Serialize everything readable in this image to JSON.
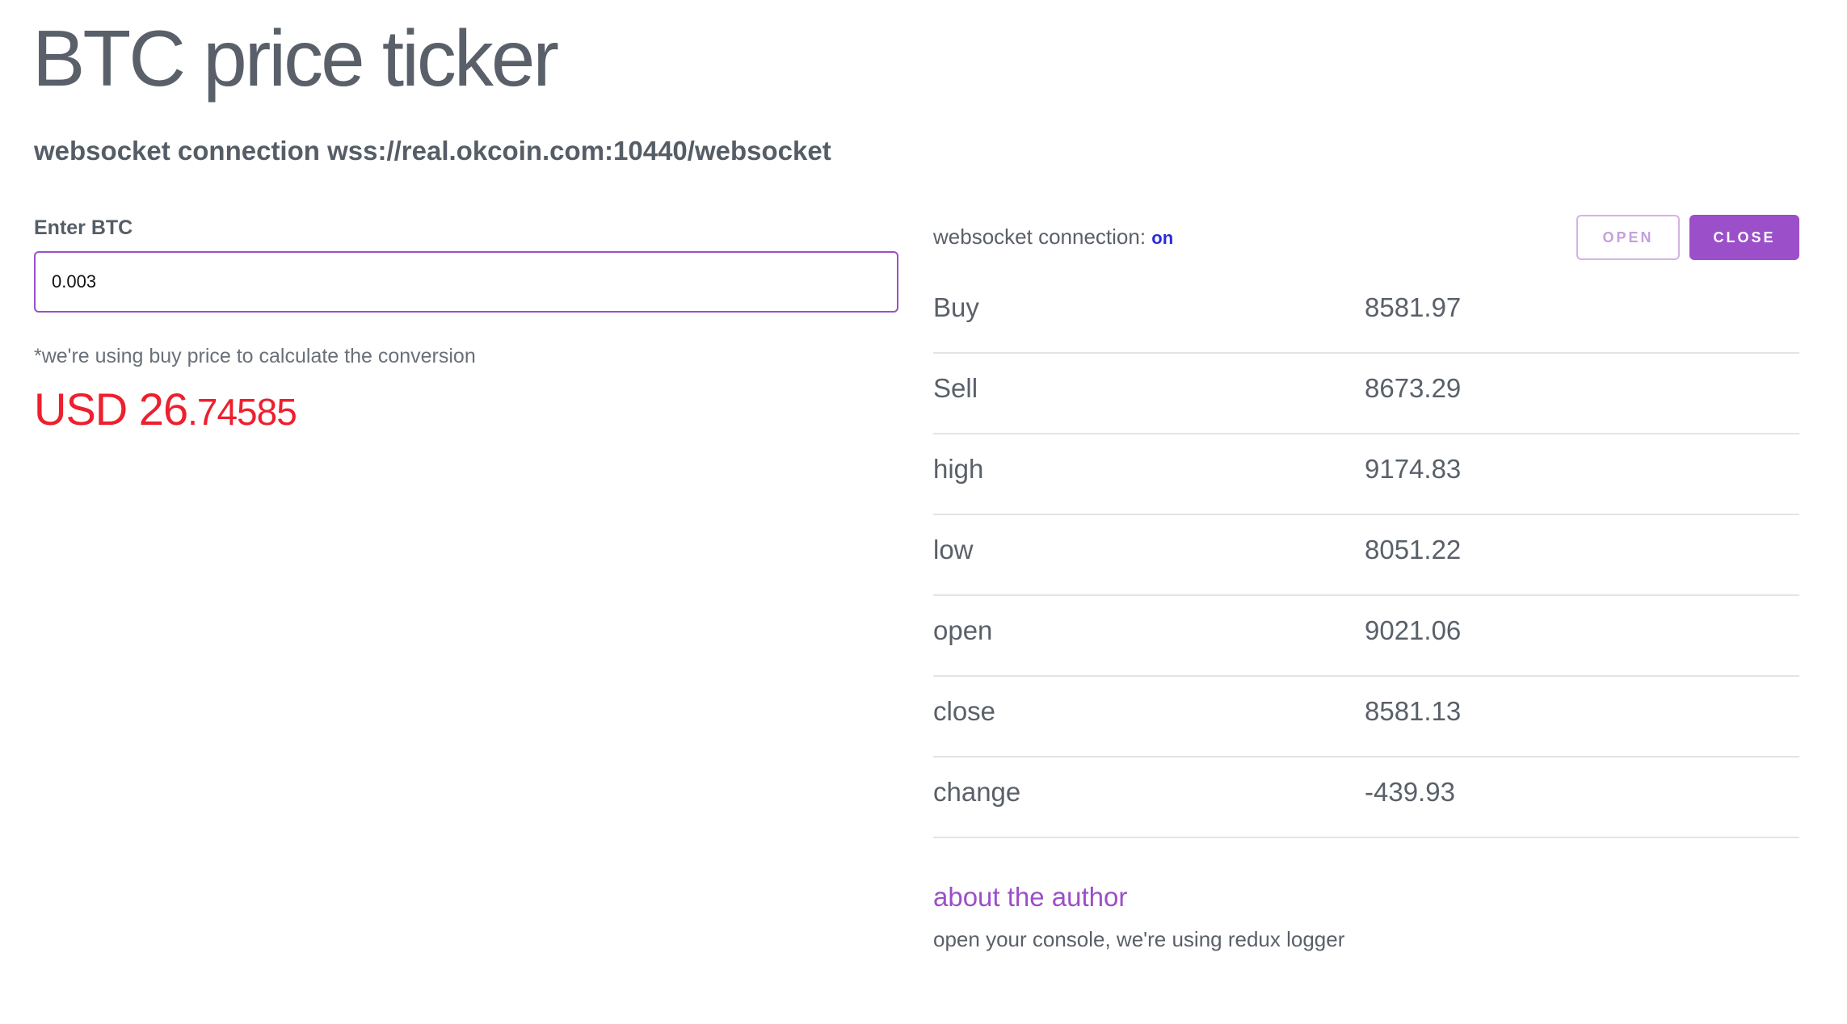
{
  "header": {
    "title": "BTC price ticker",
    "subtitle": "websocket connection wss://real.okcoin.com:10440/websocket"
  },
  "converter": {
    "label": "Enter BTC",
    "input_value": "0.003",
    "note": "*we're using buy price to calculate the conversion",
    "result_prefix": "USD 26",
    "result_decimals": ".74585"
  },
  "connection": {
    "label": "websocket connection:",
    "state": "on",
    "open_label": "OPEN",
    "close_label": "CLOSE"
  },
  "ticker": [
    {
      "key": "Buy",
      "value": "8581.97"
    },
    {
      "key": "Sell",
      "value": "8673.29"
    },
    {
      "key": "high",
      "value": "9174.83"
    },
    {
      "key": "low",
      "value": "8051.22"
    },
    {
      "key": "open",
      "value": "9021.06"
    },
    {
      "key": "close",
      "value": "8581.13"
    },
    {
      "key": "change",
      "value": "-439.93"
    }
  ],
  "footer": {
    "author_link": "about the author",
    "note": "open your console, we're using redux logger"
  },
  "colors": {
    "accent": "#9b4fc9",
    "usd_red": "#ee1f2e",
    "status_on": "#2a2ad9"
  }
}
